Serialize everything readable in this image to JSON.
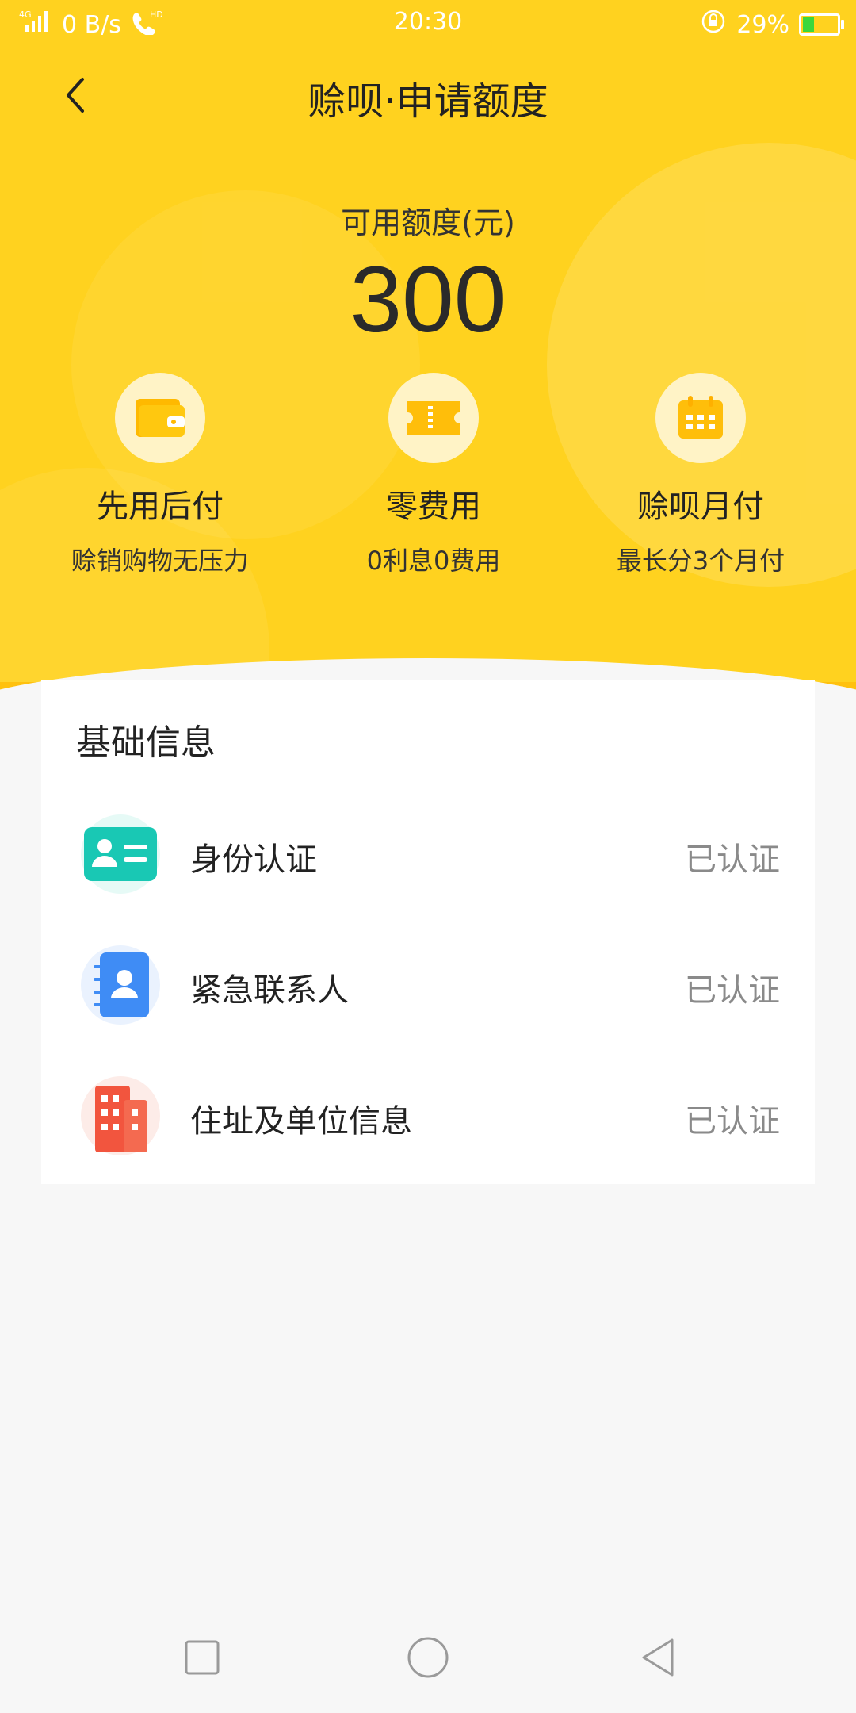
{
  "status_bar": {
    "network": "4G",
    "speed": "0 B/s",
    "hd": "HD",
    "time": "20:30",
    "battery": "29%"
  },
  "header": {
    "title": "赊呗·申请额度"
  },
  "credit": {
    "label": "可用额度(元)",
    "amount": "300"
  },
  "features": [
    {
      "icon": "wallet-icon",
      "name": "先用后付",
      "desc": "赊销购物无压力"
    },
    {
      "icon": "ticket-icon",
      "name": "零费用",
      "desc": "0利息0费用"
    },
    {
      "icon": "calendar-icon",
      "name": "赊呗月付",
      "desc": "最长分3个月付"
    }
  ],
  "basic_info": {
    "title": "基础信息",
    "items": [
      {
        "icon": "id-card-icon",
        "label": "身份认证",
        "status": "已认证"
      },
      {
        "icon": "contact-book-icon",
        "label": "紧急联系人",
        "status": "已认证"
      },
      {
        "icon": "building-icon",
        "label": "住址及单位信息",
        "status": "已认证"
      }
    ]
  },
  "colors": {
    "brand_yellow": "#FFD21F",
    "icon_teal": "#19C8B4",
    "icon_blue": "#3F8CF5",
    "icon_red": "#F2553E"
  }
}
